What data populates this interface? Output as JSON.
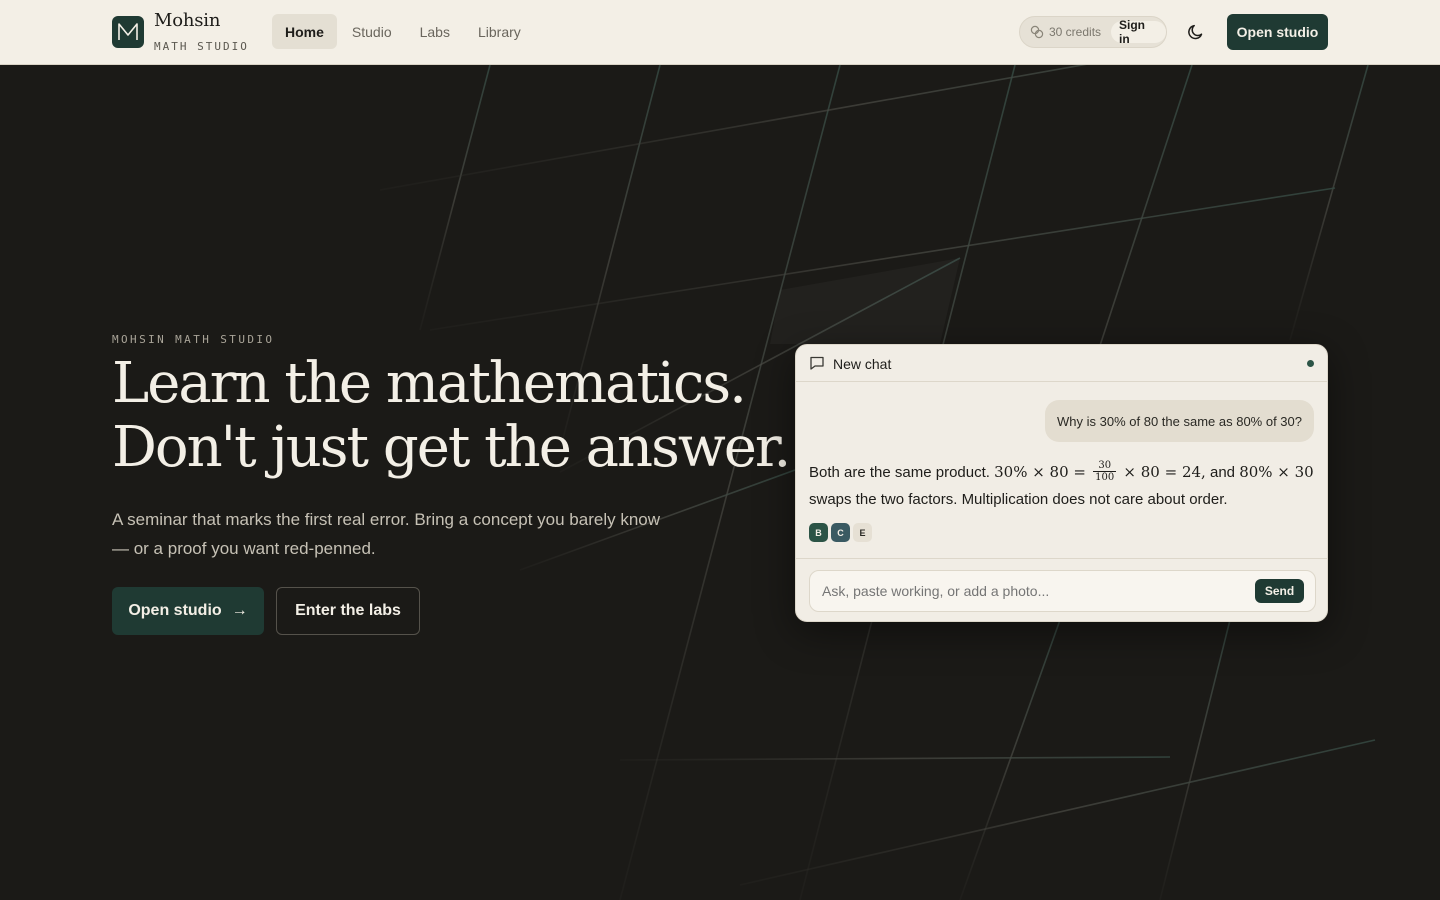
{
  "header": {
    "brand_name": "Mohsin",
    "brand_sub": "MATH STUDIO",
    "logo_letter": "M",
    "nav": [
      {
        "label": "Home",
        "active": true
      },
      {
        "label": "Studio",
        "active": false
      },
      {
        "label": "Labs",
        "active": false
      },
      {
        "label": "Library",
        "active": false
      }
    ],
    "credits_label": "30 credits",
    "signin_label": "Sign in",
    "open_studio_label": "Open studio",
    "icons": {
      "credits": "coins-icon",
      "theme": "moon-icon"
    }
  },
  "hero": {
    "eyebrow": "MOHSIN MATH STUDIO",
    "headline_line1": "Learn the mathematics.",
    "headline_line2": "Don't just get the answer.",
    "lede": "A seminar that marks the first real error. Bring a concept you barely know — or a proof you want red-penned.",
    "cta_primary": "Open studio",
    "cta_primary_arrow": "→",
    "cta_secondary": "Enter the labs"
  },
  "chat": {
    "title": "New chat",
    "user_message": "Why is 30% of 80 the same as 80% of 30?",
    "answer": {
      "intro": "Both are the same product.",
      "expr_a": "30% × 80 =",
      "frac_num": "30",
      "frac_den": "100",
      "expr_b": "× 80 = 24,",
      "and_text": "and",
      "expr_c": "80% × 30",
      "rest": "swaps the two factors. Multiplication does not care about order."
    },
    "chips": [
      "B",
      "C",
      "E"
    ],
    "composer_placeholder": "Ask, paste working, or add a photo...",
    "send_label": "Send"
  },
  "colors": {
    "background": "#1b1a17",
    "surface": "#f3efe6",
    "accent": "#1f3a33"
  }
}
